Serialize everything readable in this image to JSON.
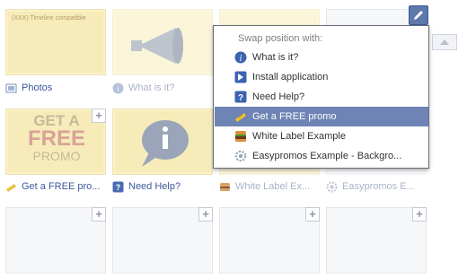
{
  "grid": {
    "rows": [
      [
        {
          "label": "Photos",
          "faded": false,
          "icon": "photos-icon"
        },
        {
          "label": "What is it?",
          "faded": true,
          "icon": "info-icon"
        },
        {
          "label": "",
          "faded": true,
          "icon": ""
        },
        {
          "label": "",
          "faded": false,
          "icon": ""
        }
      ],
      [
        {
          "label": "Get a FREE pro...",
          "faded": false,
          "icon": "ticket-icon"
        },
        {
          "label": "Need Help?",
          "faded": false,
          "icon": "help-icon"
        },
        {
          "label": "White Label Ex...",
          "faded": true,
          "icon": "burger-icon"
        },
        {
          "label": "Easypromos E...",
          "faded": true,
          "icon": "gear-icon"
        }
      ]
    ],
    "promo_tile": {
      "line1": "GET A",
      "line2": "FREE",
      "line3": "PROMO"
    },
    "tile_small_text": "(XXX) Timeline compatible"
  },
  "menu": {
    "header": "Swap position with:",
    "items": [
      {
        "label": "What is it?",
        "icon": "info-icon",
        "active": false
      },
      {
        "label": "Install application",
        "icon": "install-icon",
        "active": false
      },
      {
        "label": "Need Help?",
        "icon": "help-icon",
        "active": false
      },
      {
        "label": "Get a FREE promo",
        "icon": "ticket-icon",
        "active": true
      },
      {
        "label": "White Label Example",
        "icon": "burger-icon",
        "active": false
      },
      {
        "label": "Easypromos Example - Backgro...",
        "icon": "gear-icon",
        "active": false
      }
    ]
  },
  "colors": {
    "link": "#3b5998",
    "menu_active_bg": "#6d84b4",
    "app_tile_bg": "#fbf1c6"
  }
}
